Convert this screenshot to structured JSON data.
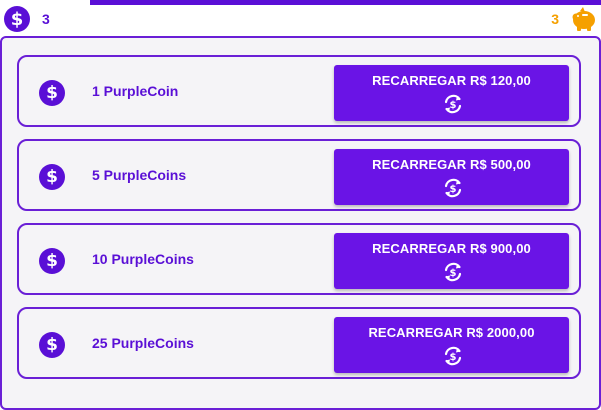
{
  "header": {
    "coin_symbol": "$",
    "purplecoin_count": "3",
    "goldcoin_count": "3",
    "icons": [
      "dollar-coin-icon",
      "piggy-bank-icon"
    ],
    "colors": {
      "purple": "#5a0fd6",
      "gold": "#f5a000"
    }
  },
  "packages": [
    {
      "coin_symbol": "$",
      "label": "1 PurpleCoin",
      "button": "RECARREGAR R$ 120,00"
    },
    {
      "coin_symbol": "$",
      "label": "5 PurpleCoins",
      "button": "RECARREGAR R$ 500,00"
    },
    {
      "coin_symbol": "$",
      "label": "10 PurpleCoins",
      "button": "RECARREGAR R$ 900,00"
    },
    {
      "coin_symbol": "$",
      "label": "25 PurpleCoins",
      "button": "RECARREGAR R$ 2000,00"
    }
  ],
  "button_icon": "recharge-cycle-icon"
}
